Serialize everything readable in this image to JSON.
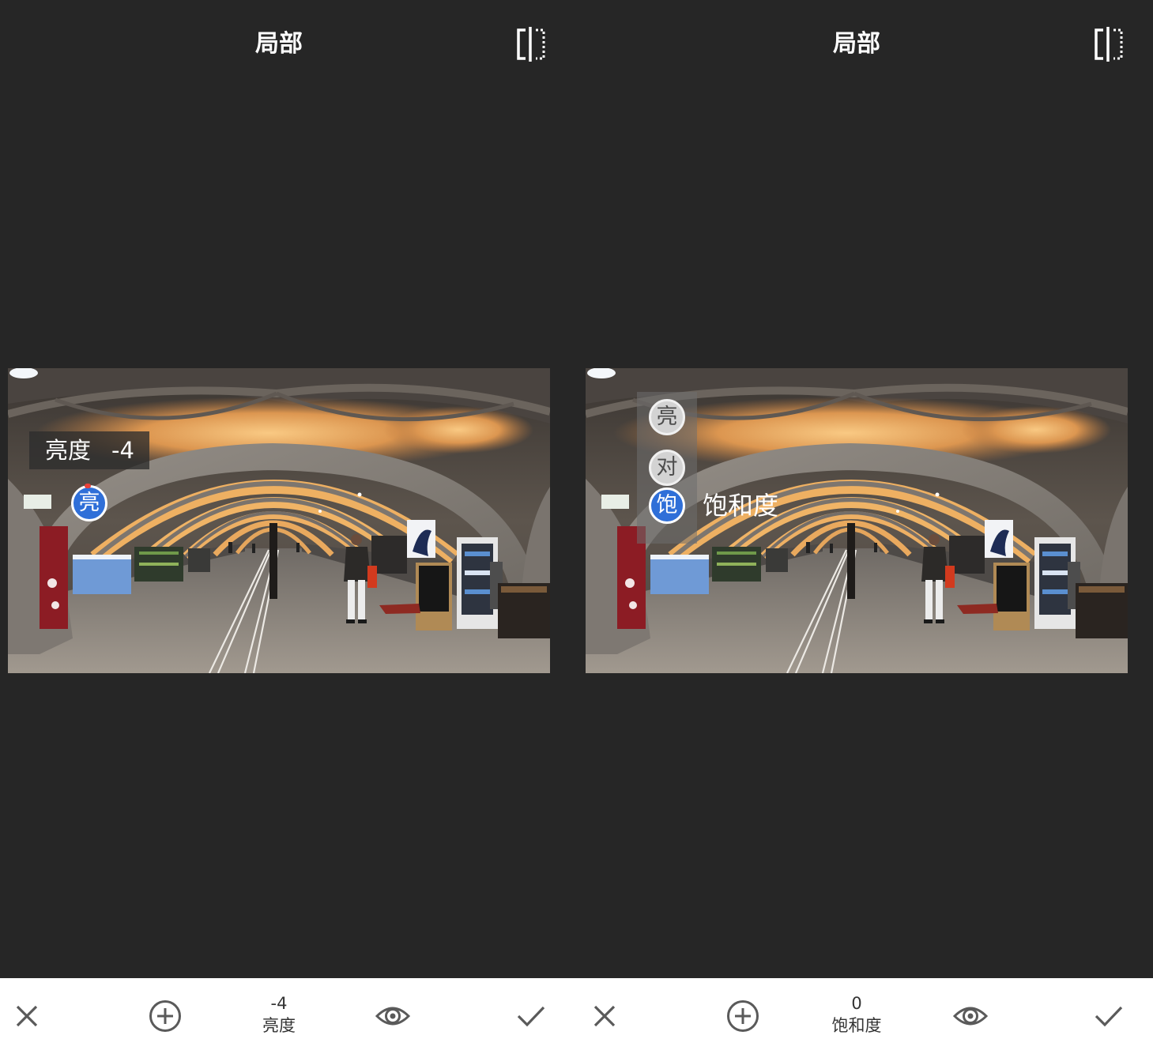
{
  "panels": [
    {
      "title": "局部",
      "compare_icon": "compare-icon",
      "adjustment_label": {
        "name": "亮度",
        "value": "-4"
      },
      "control_point": {
        "glyph": "亮"
      },
      "toolbar": {
        "value": "-4",
        "parameter": "亮度"
      }
    },
    {
      "title": "局部",
      "compare_icon": "compare-icon",
      "parameter_menu": {
        "items": [
          {
            "glyph": "亮",
            "selected": false
          },
          {
            "glyph": "对",
            "selected": false
          },
          {
            "glyph": "饱",
            "selected": true
          }
        ],
        "selected_label": "饱和度"
      },
      "toolbar": {
        "value": "0",
        "parameter": "饱和度"
      }
    }
  ],
  "toolbar_icons": [
    "cancel-icon",
    "add-control-point-icon",
    "eye-icon",
    "check-icon"
  ],
  "colors": {
    "background": "#262626",
    "accent": "#2f6fd8",
    "toolbar_background": "#ffffff",
    "toolbar_icon": "#5a5a5a"
  }
}
